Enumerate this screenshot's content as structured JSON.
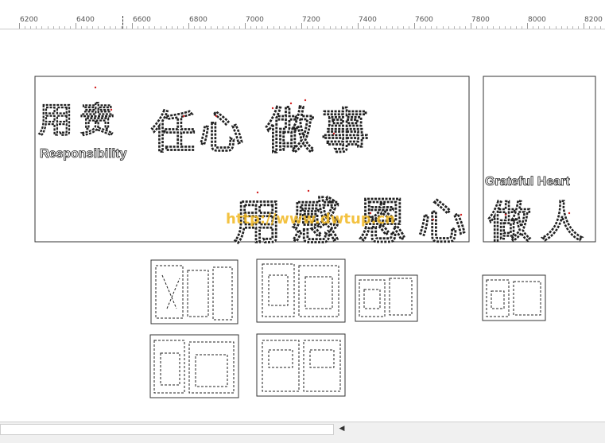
{
  "ruler": {
    "labels": [
      "6200",
      "6400",
      "6600",
      "6800",
      "7000",
      "7200",
      "7400",
      "7600",
      "7800",
      "8000",
      "8200"
    ]
  },
  "panel_main": {
    "line1_chars": [
      "用",
      "责",
      "任",
      "心",
      "做",
      "事"
    ],
    "english1": "Responsibility",
    "line2_chars": [
      "用",
      "感",
      "恩",
      "心"
    ]
  },
  "panel_right": {
    "english": "Grateful Heart",
    "chars": [
      "做",
      "人"
    ]
  },
  "watermark": "http://www.dwtup.cn",
  "colors": {
    "marker": "#d12020",
    "watermark": "#f2b820",
    "stroke": "#222222"
  }
}
